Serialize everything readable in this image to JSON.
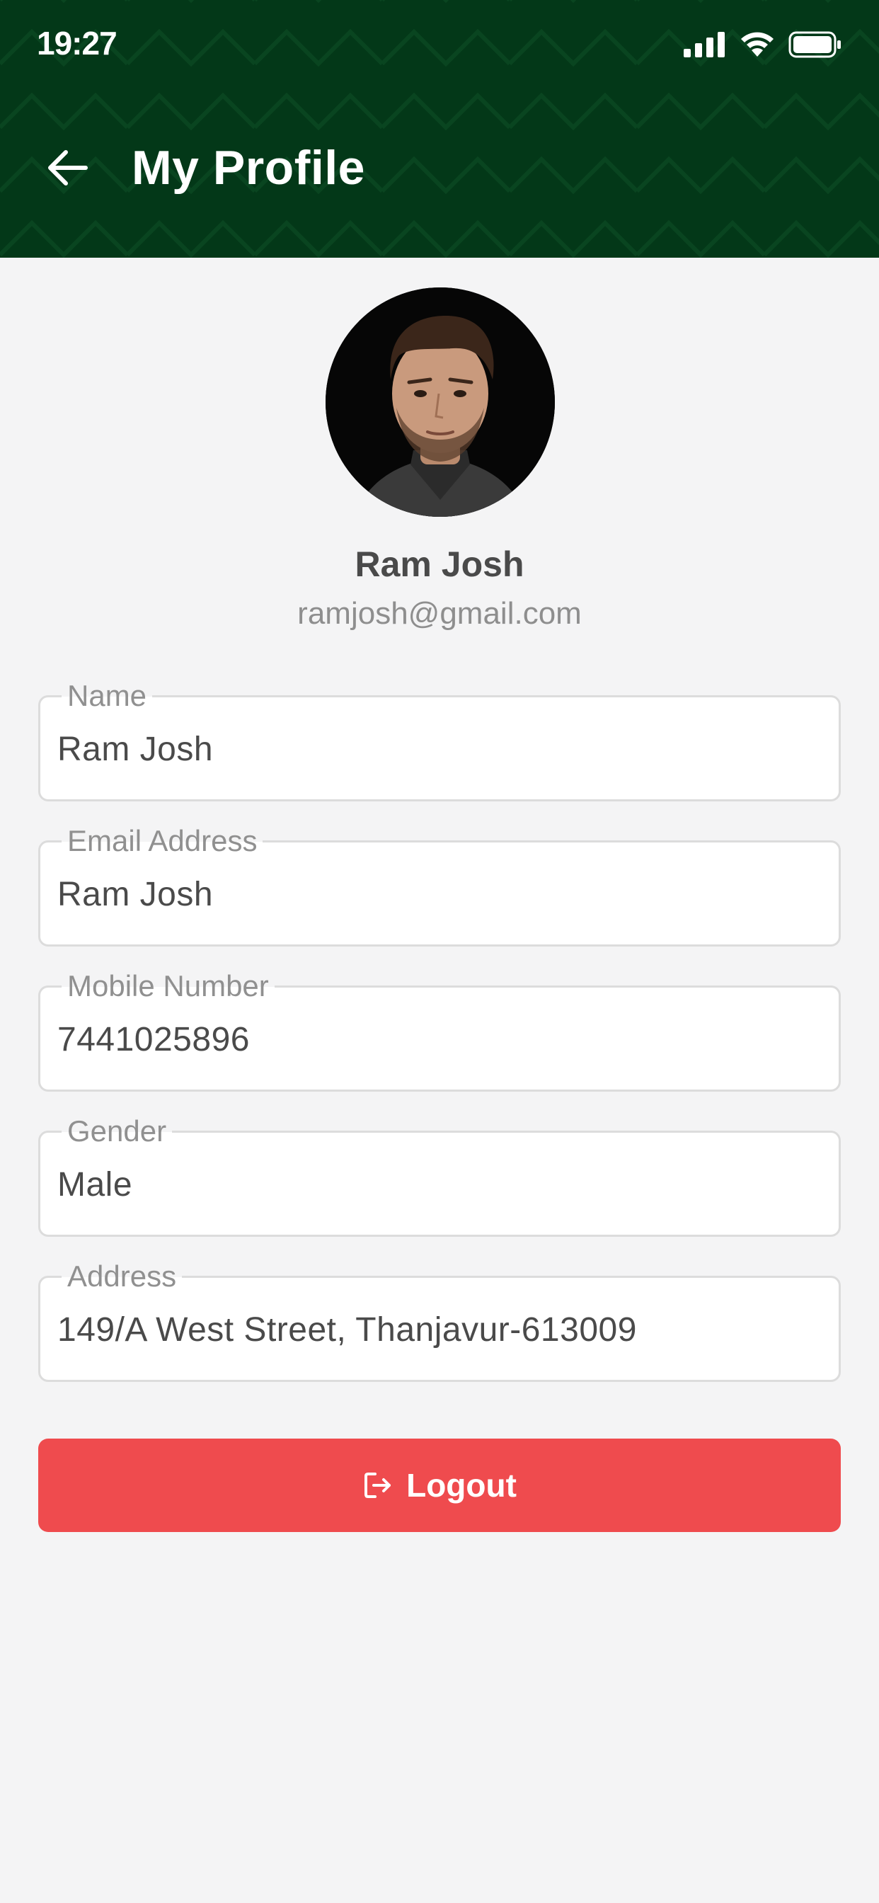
{
  "status_bar": {
    "time": "19:27"
  },
  "header": {
    "title": "My Profile",
    "background_color": "#033818"
  },
  "profile": {
    "name": "Ram Josh",
    "email": "ramjosh@gmail.com"
  },
  "fields": [
    {
      "label": "Name",
      "value": "Ram Josh"
    },
    {
      "label": "Email Address",
      "value": "Ram Josh"
    },
    {
      "label": "Mobile Number",
      "value": "7441025896"
    },
    {
      "label": "Gender",
      "value": "Male"
    },
    {
      "label": "Address",
      "value": "149/A West Street, Thanjavur-613009"
    }
  ],
  "logout": {
    "label": "Logout",
    "color": "#ef4b4e"
  },
  "icons": {
    "back": "arrow-left-icon",
    "signal": "cellular-signal-icon",
    "wifi": "wifi-icon",
    "battery": "battery-icon",
    "logout": "logout-icon"
  }
}
